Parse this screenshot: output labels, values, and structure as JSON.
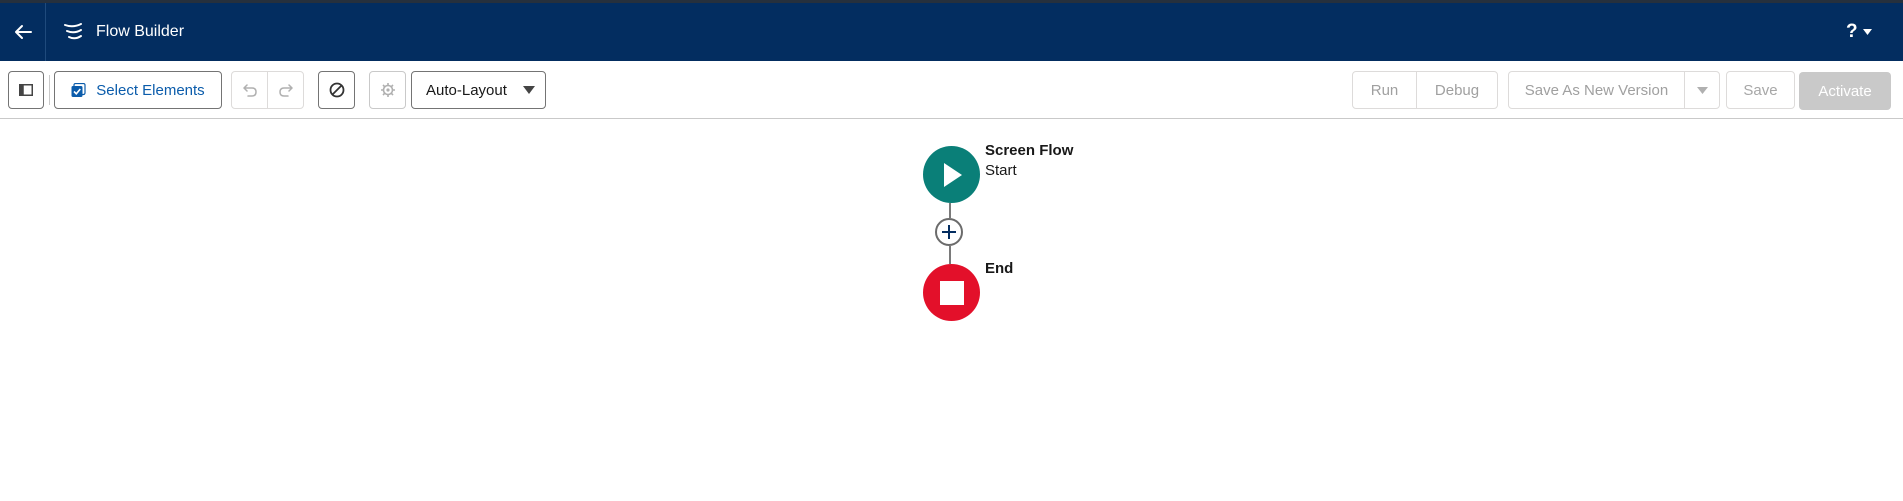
{
  "header": {
    "app_title": "Flow Builder",
    "help_label": "?"
  },
  "toolbar": {
    "select_elements_label": "Select Elements",
    "layout_selected": "Auto-Layout",
    "run_label": "Run",
    "debug_label": "Debug",
    "save_as_new_version_label": "Save As New Version",
    "save_label": "Save",
    "activate_label": "Activate"
  },
  "canvas": {
    "start_node": {
      "title": "Screen Flow",
      "subtitle": "Start"
    },
    "end_node": {
      "title": "End"
    }
  },
  "colors": {
    "header_bg": "#032d60",
    "start_node": "#0a7f78",
    "end_node": "#e3102a",
    "select_elements_text": "#0b5cab",
    "activate_disabled": "#c9c9c9"
  },
  "icons": [
    "back-arrow-icon",
    "flow-app-icon",
    "help-icon",
    "chevron-down-icon",
    "toggle-panel-icon",
    "checkbox-select-icon",
    "undo-icon",
    "redo-icon",
    "no-entry-icon",
    "gear-icon",
    "play-icon",
    "plus-icon",
    "stop-icon"
  ]
}
